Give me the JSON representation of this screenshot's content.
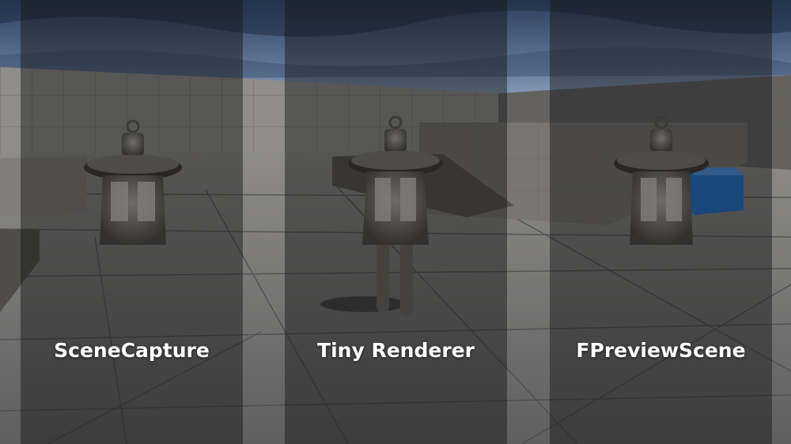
{
  "panels": [
    {
      "label": "SceneCapture"
    },
    {
      "label": "Tiny Renderer"
    },
    {
      "label": "FPreviewScene"
    }
  ],
  "colors": {
    "sky_top": "#2c3f5c",
    "sky_bottom": "#8fa3bd",
    "wall": "#8c8b88",
    "floor": "#6a6a6a",
    "panel_tint": "#141414",
    "cube": "#1e6fd0",
    "label_text": "#ffffff"
  },
  "objects": {
    "lantern_icon": "lantern-icon",
    "mannequin_icon": "mannequin-icon",
    "cube_icon": "blue-cube-icon"
  }
}
